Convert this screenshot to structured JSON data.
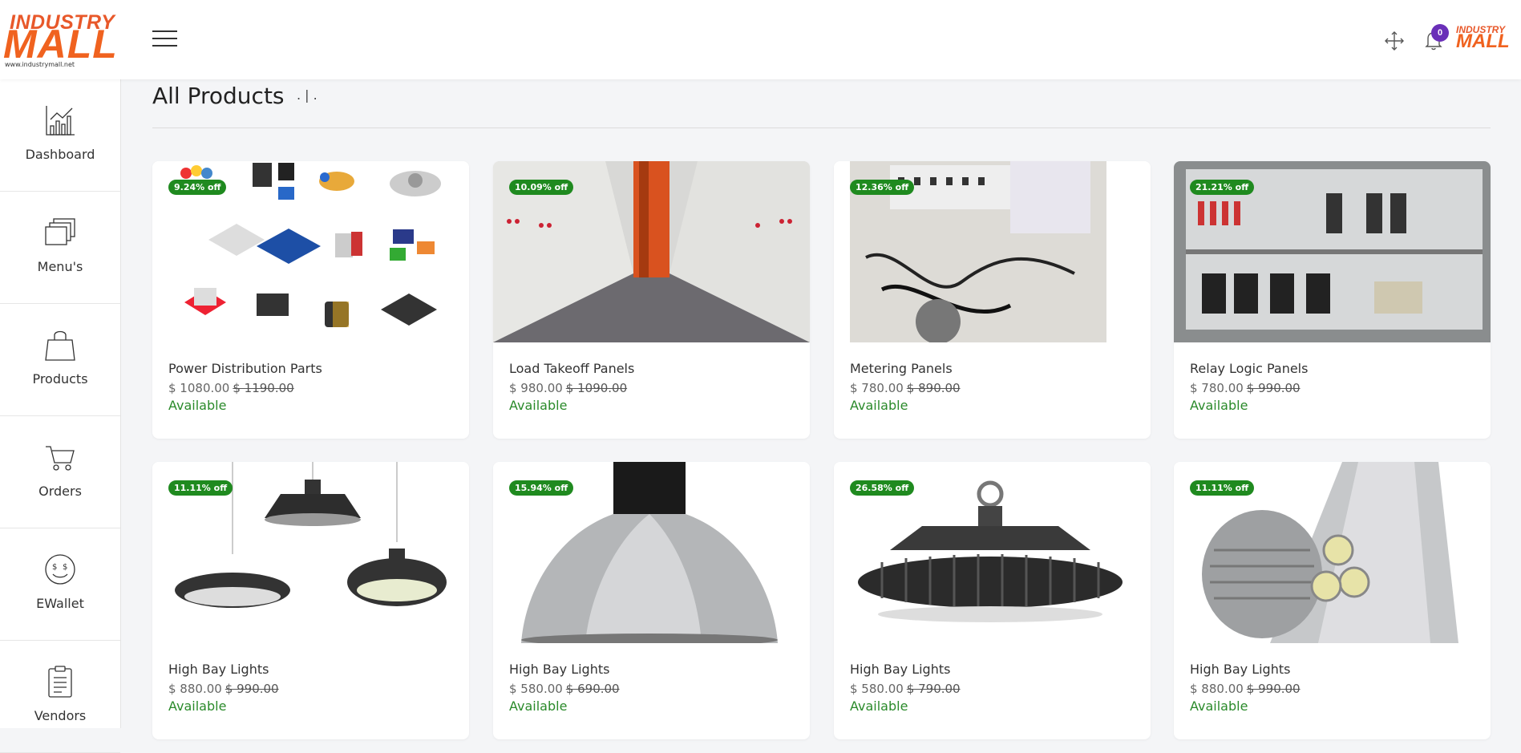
{
  "header": {
    "logo_top": "INDUSTRY",
    "logo_main": "MALL",
    "logo_url": "www.industrymall.net",
    "notification_count": "0",
    "avatar_top": "INDUSTRY",
    "avatar_main": "MALL"
  },
  "sidebar": {
    "items": [
      {
        "label": "Dashboard",
        "icon": "chart-icon"
      },
      {
        "label": "Menu's",
        "icon": "layers-icon"
      },
      {
        "label": "Products",
        "icon": "shopping-bag-icon"
      },
      {
        "label": "Orders",
        "icon": "cart-icon"
      },
      {
        "label": "EWallet",
        "icon": "wallet-icon"
      },
      {
        "label": "Vendors",
        "icon": "clipboard-icon"
      }
    ]
  },
  "main": {
    "title": "All Products",
    "title_suffix": ". | ."
  },
  "products": [
    {
      "discount": "9.24% off",
      "name": "Power Distribution Parts",
      "price": "$ 1080.00",
      "old_price": "$ 1190.00",
      "status": "Available"
    },
    {
      "discount": "10.09% off",
      "name": "Load Takeoff Panels",
      "price": "$ 980.00",
      "old_price": "$ 1090.00",
      "status": "Available"
    },
    {
      "discount": "12.36% off",
      "name": "Metering Panels",
      "price": "$ 780.00",
      "old_price": "$ 890.00",
      "status": "Available"
    },
    {
      "discount": "21.21% off",
      "name": "Relay Logic Panels",
      "price": "$ 780.00",
      "old_price": "$ 990.00",
      "status": "Available"
    },
    {
      "discount": "11.11% off",
      "name": "High Bay Lights",
      "price": "$ 880.00",
      "old_price": "$ 990.00",
      "status": "Available"
    },
    {
      "discount": "15.94% off",
      "name": "High Bay Lights",
      "price": "$ 580.00",
      "old_price": "$ 690.00",
      "status": "Available"
    },
    {
      "discount": "26.58% off",
      "name": "High Bay Lights",
      "price": "$ 580.00",
      "old_price": "$ 790.00",
      "status": "Available"
    },
    {
      "discount": "11.11% off",
      "name": "High Bay Lights",
      "price": "$ 880.00",
      "old_price": "$ 990.00",
      "status": "Available"
    }
  ],
  "colors": {
    "brand_orange": "#f0621f",
    "discount_green": "#1f8a1f",
    "available_green": "#2a8a2a",
    "badge_purple": "#6a2fb8"
  }
}
